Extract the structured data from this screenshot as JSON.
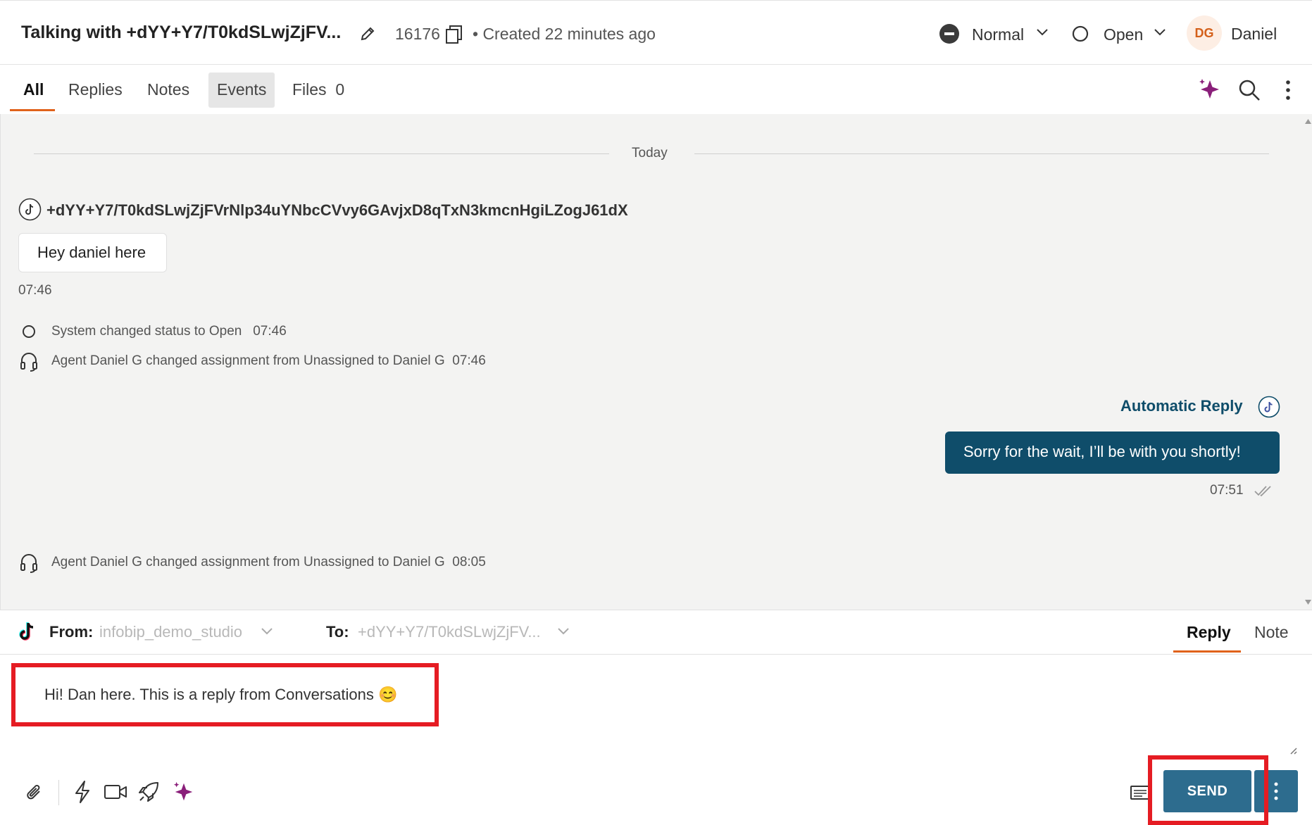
{
  "header": {
    "title": "Talking with +dYY+Y7/T0kdSLwjZjFV...",
    "ticket_id": "16176",
    "created": "• Created 22 minutes ago",
    "priority": "Normal",
    "status": "Open",
    "avatar_initials": "DG",
    "agent_name": "Daniel"
  },
  "tabs": [
    {
      "label": "All"
    },
    {
      "label": "Replies"
    },
    {
      "label": "Notes"
    },
    {
      "label": "Events"
    },
    {
      "label": "Files"
    }
  ],
  "files_count": "0",
  "conversation": {
    "date_divider": "Today",
    "contact_handle": "+dYY+Y7/T0kdSLwjZjFVrNlp34uYNbcCVvy6GAvjxD8qTxN3kmcnHgiLZogJ61dX",
    "incoming_message": "Hey daniel here",
    "incoming_time": "07:46",
    "events": [
      {
        "text": "System changed status to Open",
        "time": "07:46"
      },
      {
        "text": "Agent Daniel G  changed assignment from Unassigned to Daniel G",
        "time": "07:46"
      },
      {
        "text": "Agent Daniel G changed assignment from Unassigned to Daniel G",
        "time": "08:05"
      }
    ],
    "auto_reply_label": "Automatic Reply",
    "outgoing_message": "Sorry for the wait, I’ll be with you shortly!",
    "outgoing_time": "07:51"
  },
  "composer": {
    "from_label": "From:",
    "from_value": "infobip_demo_studio",
    "to_label": "To:",
    "to_value": "+dYY+Y7/T0kdSLwjZjFV...",
    "mode_reply": "Reply",
    "mode_note": "Note",
    "draft_text": "Hi! Dan here. This is a reply from Conversations 😊",
    "send_label": "SEND"
  },
  "colors": {
    "accent_orange": "#e0621b",
    "outgoing_bubble": "#0f4d6a",
    "send_button": "#2d6c8e",
    "ai_sparkle": "#8a1f7a",
    "highlight_red": "#e51c23"
  }
}
